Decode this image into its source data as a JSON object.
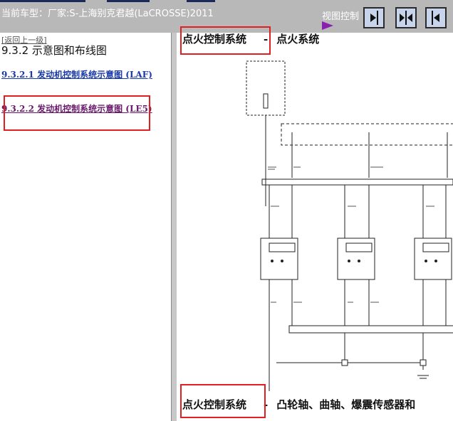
{
  "header": {
    "vehicle_text": "当前车型：厂家:S-上海别克君越(LaCROSSE)2011",
    "view_control_label": "视图控制",
    "buttons": [
      {
        "name": "expand-right",
        "icon": "arrow-right-icon"
      },
      {
        "name": "split-both",
        "icon": "split-icon"
      },
      {
        "name": "collapse-left",
        "icon": "arrow-left-icon"
      }
    ]
  },
  "sidebar": {
    "back_link": "[返回上一级]",
    "section_title": "9.3.2 示意图和布线图",
    "items": [
      {
        "label": "9.3.2.1 发动机控制系统示意图 (LAF)"
      },
      {
        "label": "9.3.2.2 发动机控制系统示意图 (LE5)"
      }
    ]
  },
  "content": {
    "heading_top_title": "点火控制系统",
    "heading_top_sep": "-",
    "heading_top_sub": "点火系统",
    "heading_bottom_title": "点火控制系统",
    "heading_bottom_sep": "-",
    "heading_bottom_sub": "凸轮轴、曲轴、爆震传感器和"
  },
  "colors": {
    "accent": "#e02020",
    "link": "#1a3aa8",
    "visited_link": "#6b1a6b",
    "toolbar": "#b8b8b8"
  }
}
